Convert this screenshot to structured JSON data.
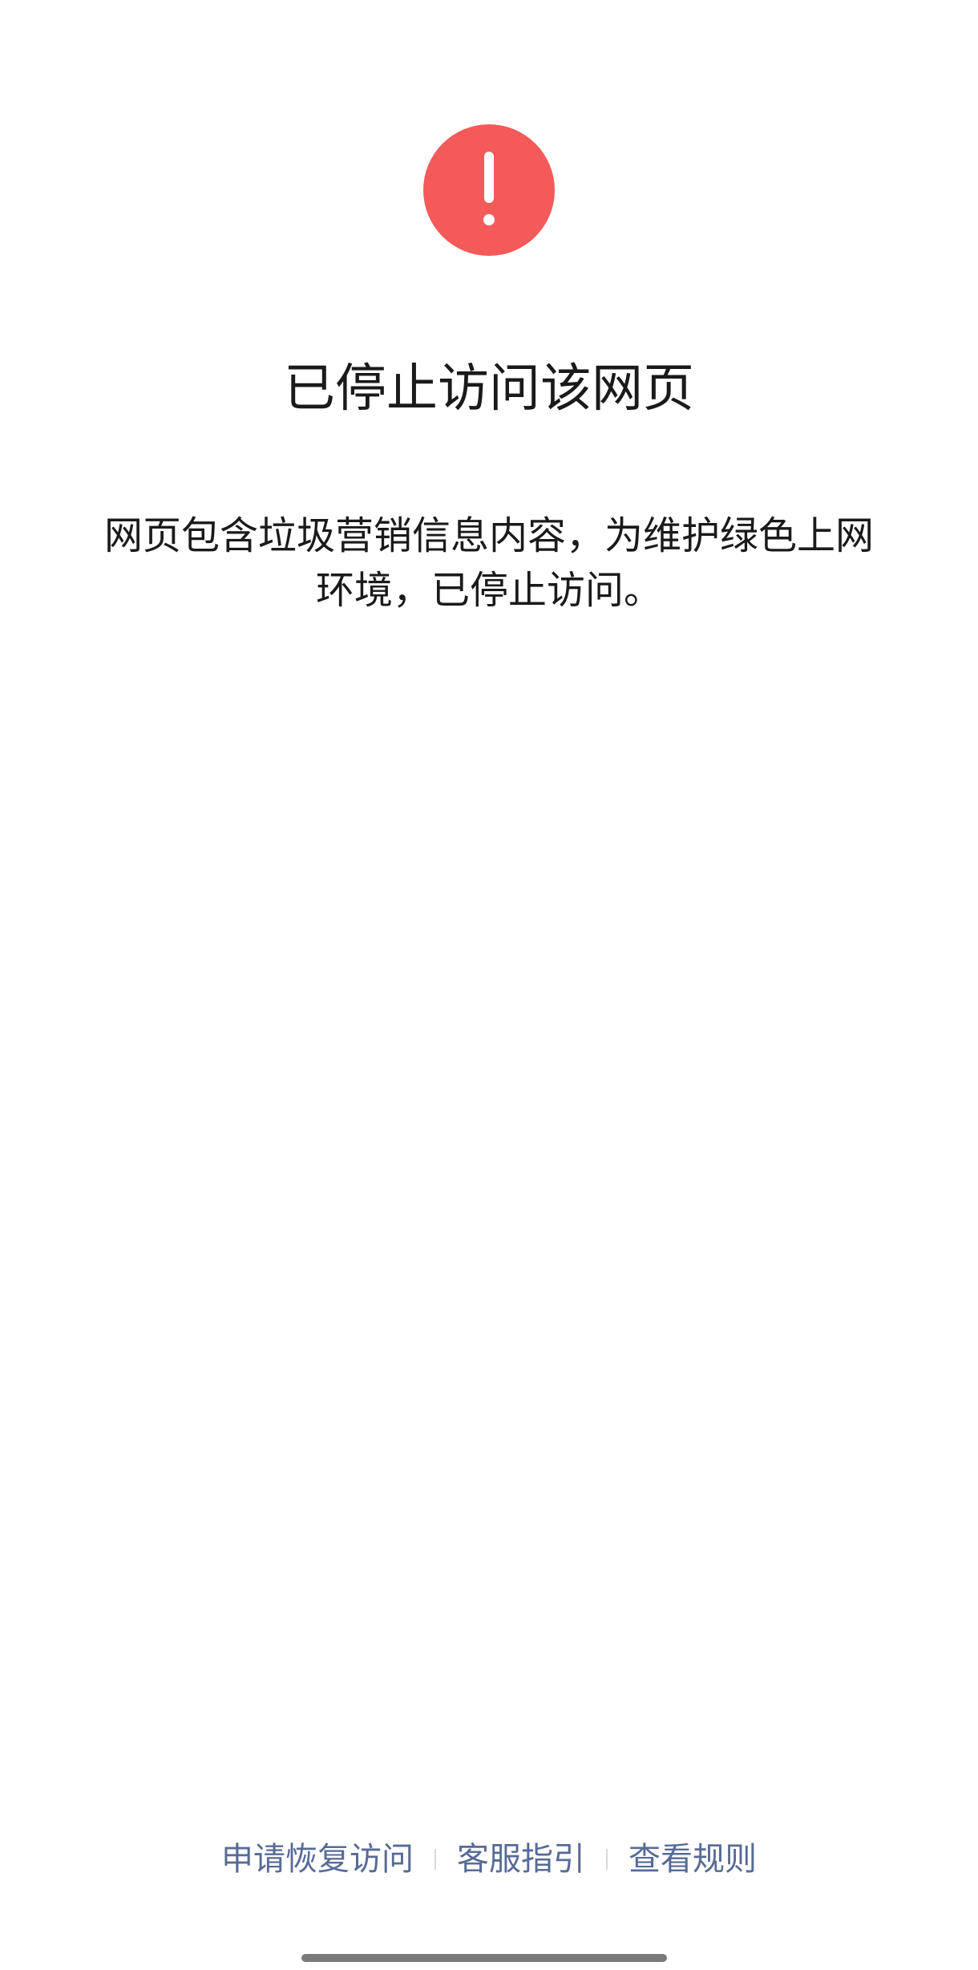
{
  "icon": {
    "name": "exclamation-icon",
    "color": "#f45a5a"
  },
  "title": "已停止访问该网页",
  "message": "网页包含垃圾营销信息内容，为维护绿色上网环境，已停止访问。",
  "footer": {
    "appeal_label": "申请恢复访问",
    "support_label": "客服指引",
    "rules_label": "查看规则",
    "link_color": "#576b95"
  }
}
